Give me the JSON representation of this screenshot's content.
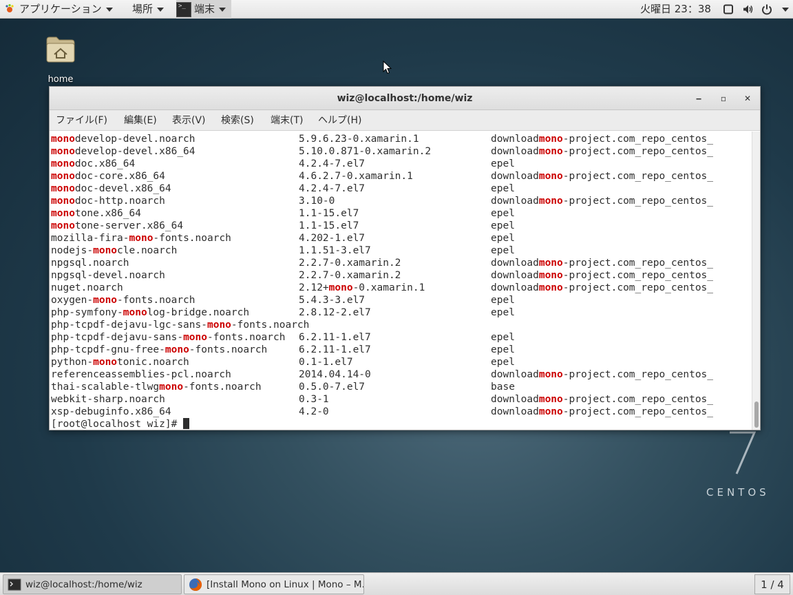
{
  "top_panel": {
    "apps_label": "アプリケーション",
    "places_label": "場所",
    "terminal_label": "端末",
    "clock": "火曜日 23：38"
  },
  "desktop": {
    "home_label": "home",
    "centos_text": "CENTOS"
  },
  "window": {
    "title": "wiz@localhost:/home/wiz",
    "minimize": "‒",
    "maximize": "▫",
    "close": "✕"
  },
  "menubar": [
    "ファイル(F)",
    "編集(E)",
    "表示(V)",
    "検索(S)",
    "端末(T)",
    "ヘルプ(H)"
  ],
  "terminal": {
    "highlight": "mono",
    "rows": [
      [
        "monodevelop-devel.noarch",
        "5.9.6.23-0.xamarin.1",
        "downloadmono-project.com_repo_centos_"
      ],
      [
        "monodevelop-devel.x86_64",
        "5.10.0.871-0.xamarin.2",
        "downloadmono-project.com_repo_centos_"
      ],
      [
        "monodoc.x86_64",
        "4.2.4-7.el7",
        "epel"
      ],
      [
        "monodoc-core.x86_64",
        "4.6.2.7-0.xamarin.1",
        "downloadmono-project.com_repo_centos_"
      ],
      [
        "monodoc-devel.x86_64",
        "4.2.4-7.el7",
        "epel"
      ],
      [
        "monodoc-http.noarch",
        "3.10-0",
        "downloadmono-project.com_repo_centos_"
      ],
      [
        "monotone.x86_64",
        "1.1-15.el7",
        "epel"
      ],
      [
        "monotone-server.x86_64",
        "1.1-15.el7",
        "epel"
      ],
      [
        "mozilla-fira-mono-fonts.noarch",
        "4.202-1.el7",
        "epel"
      ],
      [
        "nodejs-monocle.noarch",
        "1.1.51-3.el7",
        "epel"
      ],
      [
        "npgsql.noarch",
        "2.2.7-0.xamarin.2",
        "downloadmono-project.com_repo_centos_"
      ],
      [
        "npgsql-devel.noarch",
        "2.2.7-0.xamarin.2",
        "downloadmono-project.com_repo_centos_"
      ],
      [
        "nuget.noarch",
        "2.12+mono-0.xamarin.1",
        "downloadmono-project.com_repo_centos_"
      ],
      [
        "oxygen-mono-fonts.noarch",
        "5.4.3-3.el7",
        "epel"
      ],
      [
        "php-symfony-monolog-bridge.noarch",
        "2.8.12-2.el7",
        "epel"
      ],
      [
        "php-tcpdf-dejavu-lgc-sans-mono-fonts.noarch",
        "",
        ""
      ],
      [
        "php-tcpdf-dejavu-sans-mono-fonts.noarch",
        "6.2.11-1.el7",
        "epel"
      ],
      [
        "php-tcpdf-gnu-free-mono-fonts.noarch",
        "6.2.11-1.el7",
        "epel"
      ],
      [
        "python-monotonic.noarch",
        "0.1-1.el7",
        "epel"
      ],
      [
        "referenceassemblies-pcl.noarch",
        "2014.04.14-0",
        "downloadmono-project.com_repo_centos_"
      ],
      [
        "thai-scalable-tlwgmono-fonts.noarch",
        "0.5.0-7.el7",
        "base"
      ],
      [
        "webkit-sharp.noarch",
        "0.3-1",
        "downloadmono-project.com_repo_centos_"
      ],
      [
        "xsp-debuginfo.x86_64",
        "4.2-0",
        "downloadmono-project.com_repo_centos_"
      ]
    ],
    "prompt": "[root@localhost wiz]# "
  },
  "taskbar": {
    "task_terminal": "wiz@localhost:/home/wiz",
    "task_firefox": "[Install Mono on Linux | Mono – M…",
    "workspace": "1 / 4"
  },
  "colors": {
    "highlight": "#cc0000",
    "panel_bg": "#e8e8e8",
    "desktop_bg": "#2a4555"
  },
  "icons": {
    "apps": "gnome-foot-icon",
    "home": "home-folder-icon",
    "terminal": "terminal-icon",
    "firefox": "firefox-icon",
    "tray": [
      "window-icon",
      "volume-icon",
      "power-icon"
    ]
  }
}
